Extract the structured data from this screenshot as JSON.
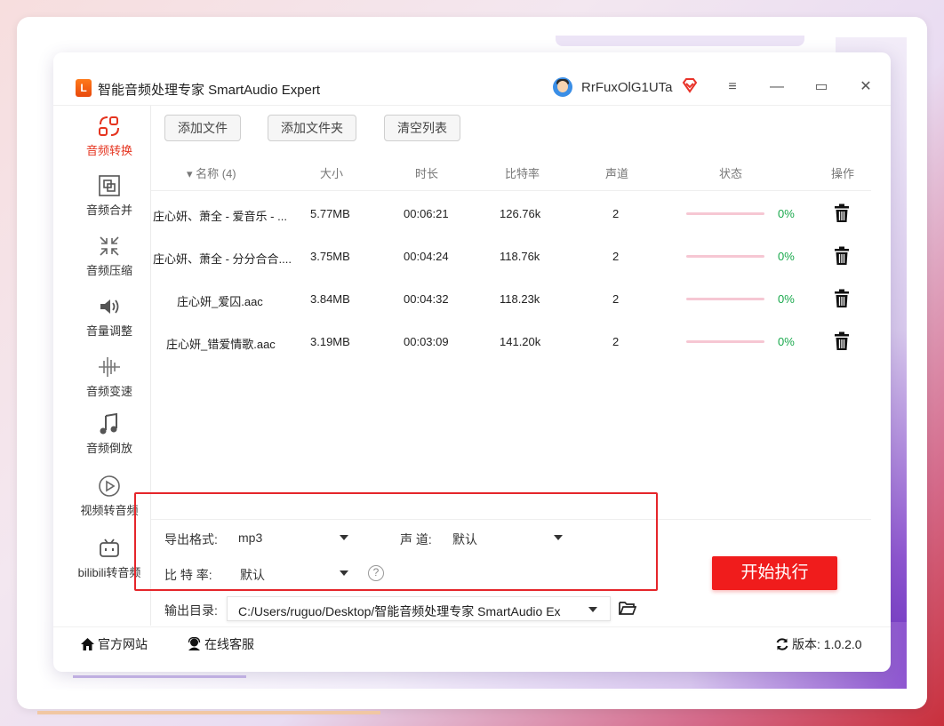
{
  "app": {
    "title": "智能音频处理专家 SmartAudio Expert",
    "logo_text": "L",
    "username": "RrFuxOlG1UTa"
  },
  "window_controls": {
    "menu": "≡",
    "minimize": "—",
    "maximize": "▭",
    "close": "✕"
  },
  "sidebar": {
    "items": [
      {
        "label": "音频转换",
        "icon": "convert-icon",
        "active": true
      },
      {
        "label": "音频合并",
        "icon": "merge-icon"
      },
      {
        "label": "音频压缩",
        "icon": "compress-icon"
      },
      {
        "label": "音量调整",
        "icon": "volume-icon"
      },
      {
        "label": "音频变速",
        "icon": "speed-icon"
      },
      {
        "label": "音频倒放",
        "icon": "reverse-music-icon"
      },
      {
        "label": "视频转音频",
        "icon": "video-play-icon"
      },
      {
        "label": "bilibili转音频",
        "icon": "bilibili-icon"
      }
    ]
  },
  "toolbar": {
    "add_file": "添加文件",
    "add_folder": "添加文件夹",
    "clear_list": "清空列表"
  },
  "table": {
    "headers": {
      "name": "▾ 名称 (4)",
      "size": "大小",
      "duration": "时长",
      "bitrate": "比特率",
      "channel": "声道",
      "status": "状态",
      "action": "操作"
    },
    "rows": [
      {
        "name": "庄心妍、萧全 - 爱音乐 - ...",
        "size": "5.77MB",
        "duration": "00:06:21",
        "bitrate": "126.76k",
        "channel": "2",
        "progress": 0,
        "pct": "0%"
      },
      {
        "name": "庄心妍、萧全 - 分分合合....",
        "size": "3.75MB",
        "duration": "00:04:24",
        "bitrate": "118.76k",
        "channel": "2",
        "progress": 0,
        "pct": "0%"
      },
      {
        "name": "庄心妍_爱囚.aac",
        "size": "3.84MB",
        "duration": "00:04:32",
        "bitrate": "118.23k",
        "channel": "2",
        "progress": 0,
        "pct": "0%"
      },
      {
        "name": "庄心妍_错爱情歌.aac",
        "size": "3.19MB",
        "duration": "00:03:09",
        "bitrate": "141.20k",
        "channel": "2",
        "progress": 0,
        "pct": "0%"
      }
    ]
  },
  "settings": {
    "format_label": "导出格式:",
    "format_value": "mp3",
    "channel_label": "声 道:",
    "channel_value": "默认",
    "bitrate_label": "比 特 率:",
    "bitrate_value": "默认",
    "help": "?",
    "outdir_label": "输出目录:",
    "outdir_value": "C:/Users/ruguo/Desktop/智能音频处理专家 SmartAudio Ex"
  },
  "start_button": "开始执行",
  "footer": {
    "website": "官方网站",
    "support": "在线客服",
    "version": "版本: 1.0.2.0"
  },
  "colors": {
    "accent_red": "#f01c1c",
    "active_label": "#e5341f",
    "progress_green": "#1aa94d"
  }
}
